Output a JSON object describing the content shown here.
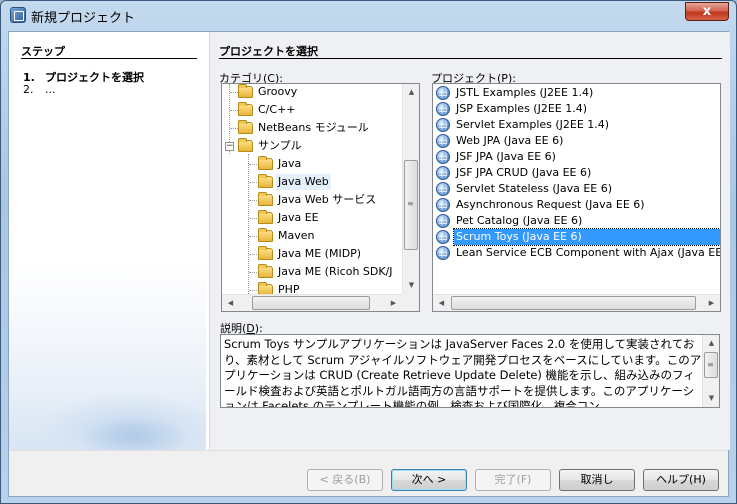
{
  "window": {
    "title": "新規プロジェクト",
    "close_glyph": "x"
  },
  "steps": {
    "title": "ステップ",
    "items": [
      {
        "num": "1.",
        "label": "プロジェクトを選択"
      },
      {
        "num": "2.",
        "label": "..."
      }
    ]
  },
  "main": {
    "title": "プロジェクトを選択",
    "categories_label": "カテゴリ(",
    "categories_mnemonic": "C",
    "categories_label_end": "):",
    "projects_label": "プロジェクト(",
    "projects_mnemonic": "P",
    "projects_label_end": "):",
    "description_label": "説明(",
    "description_mnemonic": "D",
    "description_label_end": "):"
  },
  "categories": [
    "Groovy",
    "C/C++",
    "NetBeans モジュール",
    "サンプル",
    "Java",
    "Java Web",
    "Java Web サービス",
    "Java EE",
    "Maven",
    "Java ME (MIDP)",
    "Java ME (Ricoh SDK/J",
    "PHP"
  ],
  "tree_expander": "−",
  "projects": [
    "JSTL Examples (J2EE 1.4)",
    "JSP Examples (J2EE 1.4)",
    "Servlet Examples (J2EE 1.4)",
    "Web JPA (Java EE 6)",
    "JSF JPA (Java EE 6)",
    "JSF JPA CRUD (Java EE 6)",
    "Servlet Stateless (Java EE 6)",
    "Asynchronous Request (Java EE 6)",
    "Pet Catalog (Java EE 6)",
    "Scrum Toys (Java EE 6)",
    "Lean Service ECB Component with Ajax (Java EE"
  ],
  "selected_category": "Java Web",
  "selected_project": "Scrum Toys (Java EE 6)",
  "description": "Scrum Toys サンプルアプリケーションは JavaServer Faces 2.0 を使用して実装されており、素材として Scrum アジャイルソフトウェア開発プロセスをベースにしています。このアプリケーションは CRUD (Create Retrieve Update Delete) 機能を示し、組み込みのフィールド検査および英語とポルトガル語両方の言語サポートを提供します。このアプリケーションは Facelets のテンプレート機能の例、検査および国際化、複合コン",
  "scroll": {
    "up": "▲",
    "down": "▼",
    "left": "◀",
    "right": "▶",
    "grip": "≡"
  },
  "buttons": {
    "back": "< 戻る(B)",
    "next": "次へ >",
    "finish": "完了(F)",
    "cancel": "取消し",
    "help": "ヘルプ(H)"
  },
  "colors": {
    "selection": "#3399ff",
    "title_bar": "#b9d1ea"
  }
}
